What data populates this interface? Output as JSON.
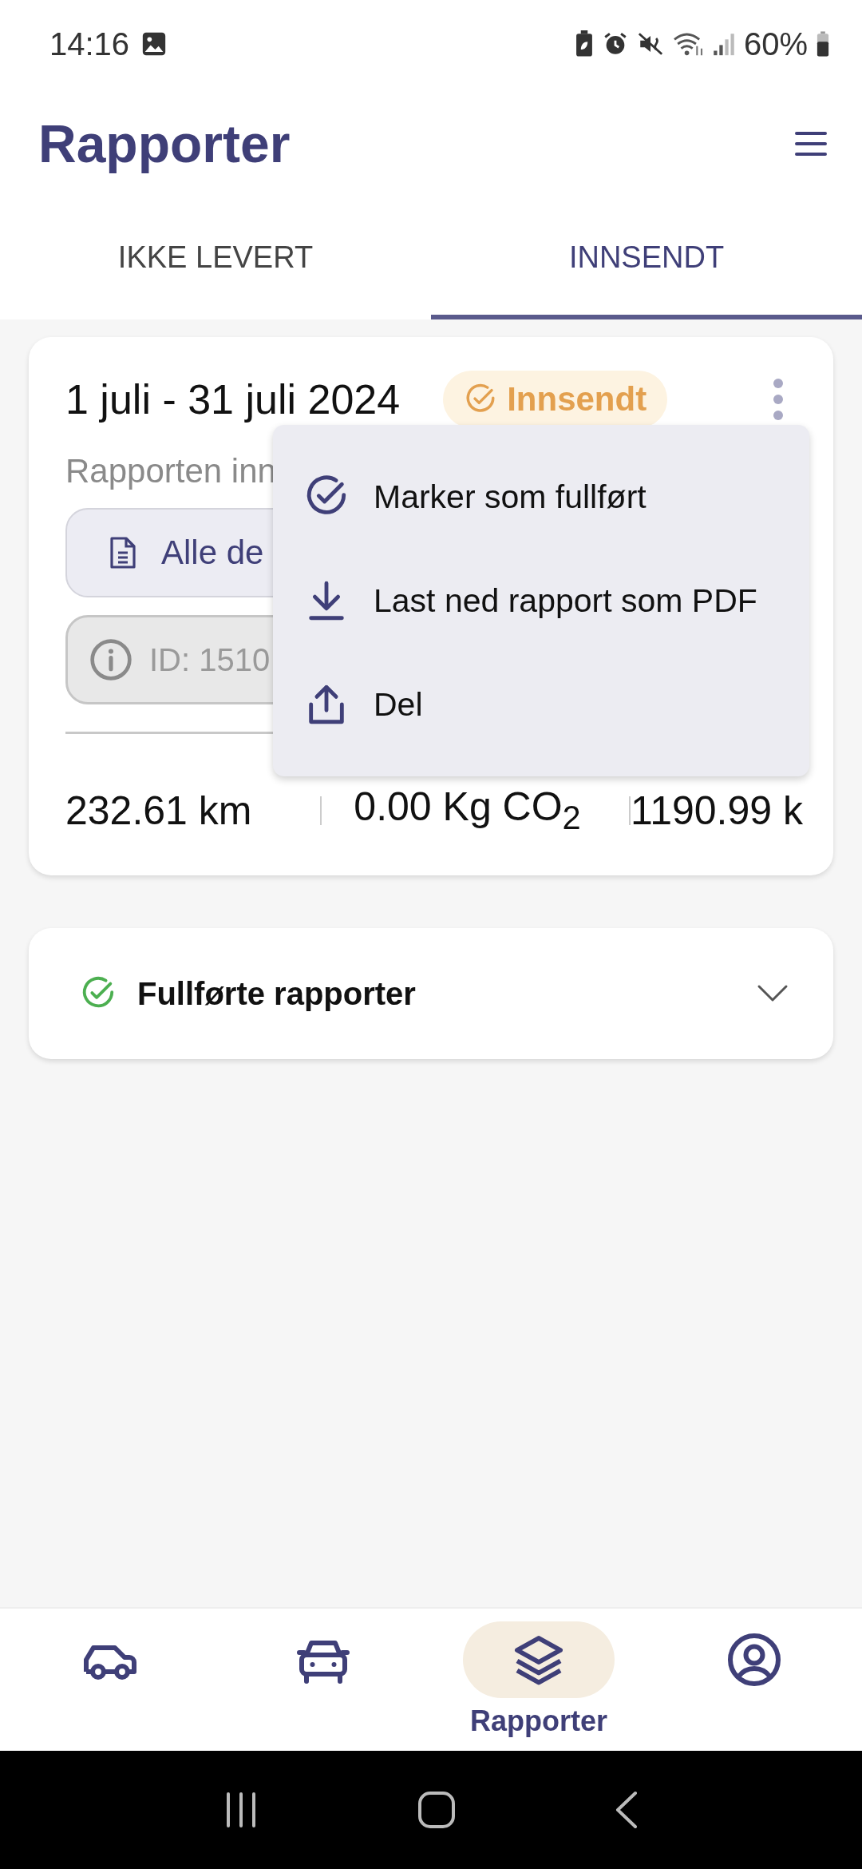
{
  "status_bar": {
    "time": "14:16",
    "battery": "60%"
  },
  "header": {
    "title": "Rapporter"
  },
  "tabs": [
    {
      "label": "IKKE LEVERT",
      "selected": false
    },
    {
      "label": "INNSENDT",
      "selected": true
    }
  ],
  "report_card": {
    "period": "1 juli - 31 juli 2024",
    "status": "Innsendt",
    "description": "Rapporten inn",
    "details_button": "Alle de",
    "id_field": "ID: 1510",
    "stats": [
      "232.61 km",
      "0.00 Kg CO$_{2}$",
      "1190.99 k"
    ]
  },
  "menu": {
    "items": [
      {
        "label": "Marker som fullført"
      },
      {
        "label": "Last ned rapport som PDF"
      },
      {
        "label": "Del"
      }
    ]
  },
  "completed_section": {
    "title": "Fullførte rapporter",
    "expanded": false
  },
  "bottom_nav": [
    {
      "selected": false
    },
    {
      "selected": false
    },
    {
      "selected": true,
      "label": "Rapporter"
    },
    {
      "selected": false
    }
  ]
}
